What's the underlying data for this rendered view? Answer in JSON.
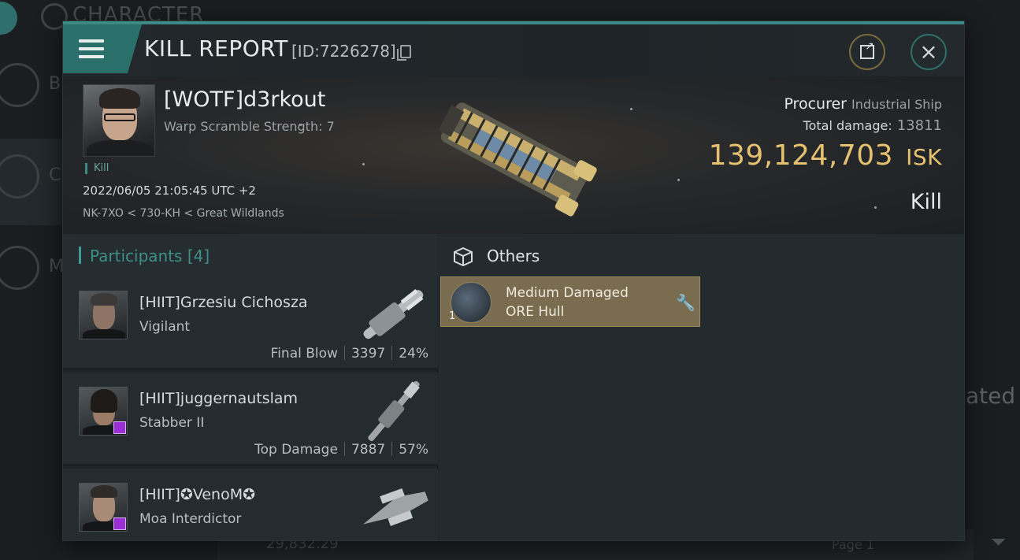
{
  "background": {
    "title": "CHARACTER",
    "side_letters": [
      "B",
      "C",
      "M"
    ],
    "right_ghost_text": "ated",
    "amount": "29,832.29",
    "page": "Page 1"
  },
  "report": {
    "title": "KILL REPORT",
    "id": "[ID:7226278]",
    "victim": {
      "name": "[WOTF]d3rkout",
      "warp_scramble": "Warp Scramble Strength: 7",
      "tag": "Kill",
      "datetime": "2022/06/05 21:05:45 UTC +2",
      "location": "NK-7XO < 730-KH < Great Wildlands"
    },
    "ship": {
      "name": "Procurer",
      "class": "Industrial Ship",
      "total_damage_label": "Total damage:",
      "total_damage": "13811",
      "isk_value": "139,124,703",
      "isk_unit": "ISK",
      "result": "Kill"
    }
  },
  "participants": {
    "header": "Participants [4]",
    "rows": [
      {
        "name": "[HIIT]Grzesiu Cichosza",
        "ship": "Vigilant",
        "role": "Final Blow",
        "damage": "3397",
        "percent": "24%"
      },
      {
        "name": "[HIIT]juggernautslam",
        "ship": "Stabber II",
        "role": "Top Damage",
        "damage": "7887",
        "percent": "57%"
      },
      {
        "name": "[HIIT]✪VenoM✪",
        "ship": "Moa Interdictor",
        "role": "",
        "damage": "",
        "percent": ""
      }
    ]
  },
  "others": {
    "header": "Others",
    "items": [
      {
        "line1": "Medium Damaged",
        "line2": "ORE Hull",
        "qty": "1"
      }
    ]
  },
  "colors": {
    "accent": "#2b6f6b",
    "isk_gold": "#e6c170",
    "item_bg": "#7a6d4f"
  }
}
